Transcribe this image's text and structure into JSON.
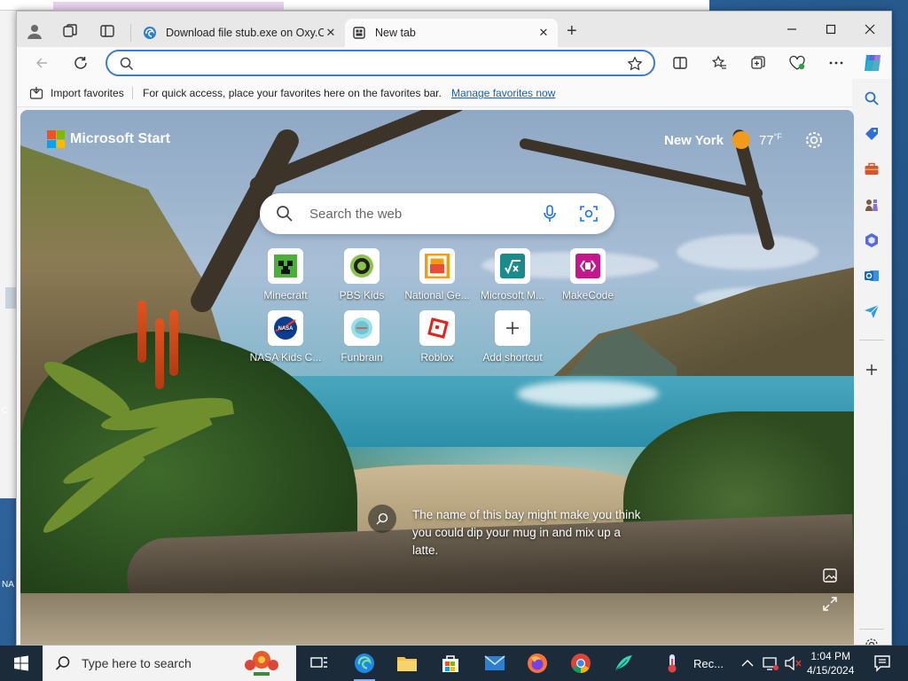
{
  "desktop": {
    "left_text_c": "C",
    "left_text_na": "NA"
  },
  "window": {
    "tabs": [
      {
        "label": "Download file stub.exe on Oxy.Cl",
        "active": false
      },
      {
        "label": "New tab",
        "active": true
      }
    ]
  },
  "address_bar": {
    "value": "",
    "placeholder": ""
  },
  "favorites_bar": {
    "import_label": "Import favorites",
    "message": "For quick access, place your favorites here on the favorites bar.",
    "manage_link": "Manage favorites now"
  },
  "start_page": {
    "brand": "Microsoft Start",
    "weather": {
      "city": "New York",
      "temp": "77",
      "unit": "°F"
    },
    "search_placeholder": "Search the web",
    "shortcuts": [
      {
        "label": "Minecraft",
        "icon": "minecraft-icon"
      },
      {
        "label": "PBS Kids",
        "icon": "pbs-kids-icon"
      },
      {
        "label": "National Ge...",
        "icon": "national-geographic-icon"
      },
      {
        "label": "Microsoft M...",
        "icon": "microsoft-math-icon"
      },
      {
        "label": "MakeCode",
        "icon": "makecode-icon"
      },
      {
        "label": "NASA Kids C...",
        "icon": "nasa-icon"
      },
      {
        "label": "Funbrain",
        "icon": "funbrain-icon"
      },
      {
        "label": "Roblox",
        "icon": "roblox-icon"
      },
      {
        "label": "Add shortcut",
        "icon": "plus-icon"
      }
    ],
    "image_caption": "The name of this bay might make you think you could dip your mug in and mix up a latte."
  },
  "taskbar": {
    "search_placeholder": "Type here to search",
    "recorder_label": "Rec...",
    "time": "1:04 PM",
    "date": "4/15/2024"
  },
  "colors": {
    "accent": "#3a7bd5",
    "link": "#1a5fb4",
    "taskbar": "#1c2b3a"
  }
}
